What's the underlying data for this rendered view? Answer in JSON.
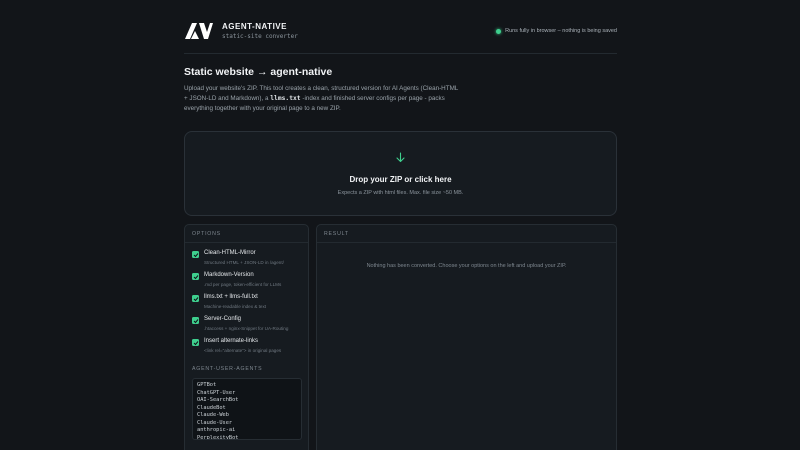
{
  "header": {
    "brand_name": "AGENT-NATIVE",
    "brand_sub": "static-site converter",
    "status_text": "Runs fully in browser – nothing is being saved"
  },
  "intro": {
    "title": "Static website → agent-native",
    "desc_part1": "Upload your website's ZIP. This tool creates a clean, structured version for AI Agents (Clean-HTML + JSON-LD and Markdown), a ",
    "desc_code": "llms.txt",
    "desc_part2": " -index and finished server configs per page - packs everything together with your original page to a new ZIP."
  },
  "dropzone": {
    "icon": "arrow-down-icon",
    "title": "Drop your ZIP or click here",
    "hint": "Expects a ZIP with html files. Max. file size ~50 MB."
  },
  "options": {
    "heading": "OPTIONS",
    "items": [
      {
        "label": "Clean-HTML-Mirror",
        "desc": "Structured HTML + JSON-LD in /agent/",
        "checked": true
      },
      {
        "label": "Markdown-Version",
        "desc": ".md per page, token-efficient for LLMs",
        "checked": true
      },
      {
        "label": "llms.txt + llms-full.txt",
        "desc": "Machine-readable index & text",
        "checked": true
      },
      {
        "label": "Server-Config",
        "desc": ".htaccess + nginx-Snippet for UA-Routing",
        "checked": true
      },
      {
        "label": "Insert alternate-links",
        "desc": "<link rel=\"alternate\"> in original pages",
        "checked": true
      }
    ],
    "ua_heading": "AGENT-USER-AGENTS",
    "ua_text": "GPTBot\nChatGPT-User\nOAI-SearchBot\nClaudeBot\nClaude-Web\nClaude-User\nanthropic-ai\nPerplexityBot"
  },
  "result": {
    "heading": "RESULT",
    "empty_text": "Nothing has been converted. Choose your options on the left and upload your ZIP."
  },
  "colors": {
    "accent": "#3ecf8e",
    "background": "#121519",
    "panel": "#161b20"
  }
}
